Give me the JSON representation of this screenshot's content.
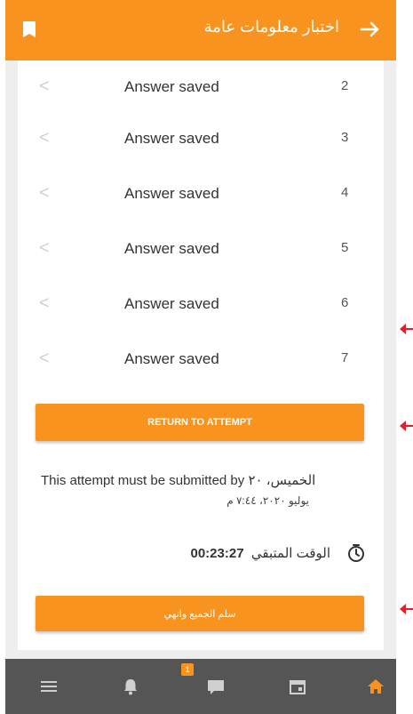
{
  "header": {
    "title": "اختبار معلومات عامة",
    "back_icon": "arrow-right-icon",
    "bookmark_icon": "bookmark-icon",
    "color": "#f7931e"
  },
  "answers": [
    {
      "status": "Answer saved",
      "number": "2"
    },
    {
      "status": "Answer saved",
      "number": "3"
    },
    {
      "status": "Answer saved",
      "number": "4"
    },
    {
      "status": "Answer saved",
      "number": "5"
    },
    {
      "status": "Answer saved",
      "number": "6"
    },
    {
      "status": "Answer saved",
      "number": "7"
    }
  ],
  "return_button": {
    "label": "RETURN TO ATTEMPT"
  },
  "submission": {
    "message": "This attempt must be submitted by الخميس، ٢٠",
    "date_line": "يوليو ٢٠٢٠، ٧:٤٤ م"
  },
  "timer": {
    "label": "الوقت المتبقي",
    "value": "00:23:27",
    "icon": "stopwatch-icon"
  },
  "submit_button": {
    "label": "سلم الجميع وانهي"
  },
  "bottom_nav": {
    "items": [
      {
        "icon": "menu-icon"
      },
      {
        "icon": "bell-icon"
      },
      {
        "icon": "chat-icon",
        "badge": "1"
      },
      {
        "icon": "calendar-icon"
      },
      {
        "icon": "home-icon",
        "active": true
      }
    ],
    "background": "#555555",
    "active_color": "#f7931e"
  }
}
